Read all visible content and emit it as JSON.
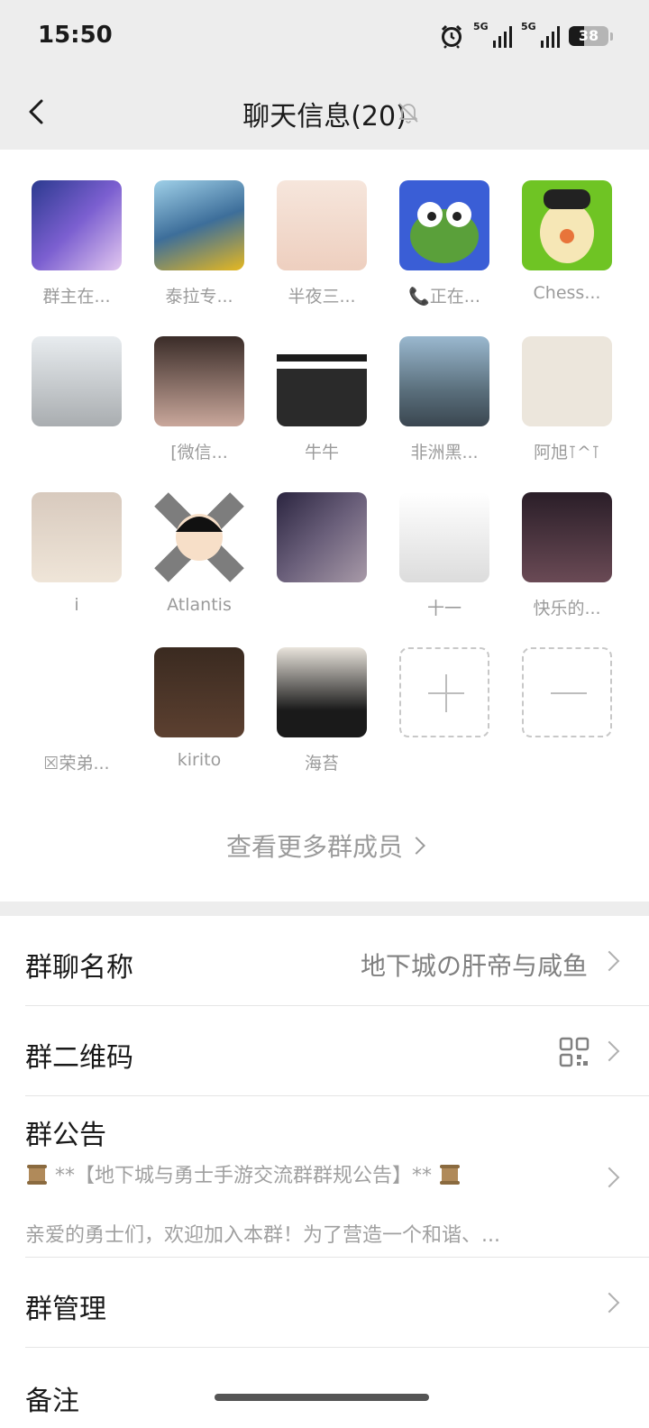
{
  "status_bar": {
    "time": "15:50",
    "network_1": "5G",
    "network_2": "5G",
    "battery_level": "38",
    "battery_fraction": 0.38,
    "icons": [
      "alarm-icon",
      "signal-icon",
      "signal-icon",
      "battery-icon"
    ]
  },
  "nav": {
    "title": "聊天信息(20)",
    "back_icon": "chevron-left-icon",
    "mute_icon": "bell-off-icon"
  },
  "members": [
    {
      "name": "群主在..."
    },
    {
      "name": "泰拉专..."
    },
    {
      "name": "半夜三..."
    },
    {
      "name": "📞正在..."
    },
    {
      "name": "Chess..."
    },
    {
      "name": ""
    },
    {
      "name": "[微信..."
    },
    {
      "name": "牛牛"
    },
    {
      "name": "非洲黑..."
    },
    {
      "name": "阿旭⊺^⊺"
    },
    {
      "name": "i"
    },
    {
      "name": "Atlantis"
    },
    {
      "name": ""
    },
    {
      "name": "十一"
    },
    {
      "name": "快乐的..."
    },
    {
      "name": "☒荣弟..."
    },
    {
      "name": "kirito"
    },
    {
      "name": "海苔"
    }
  ],
  "actions": {
    "add_icon": "plus-icon",
    "remove_icon": "minus-icon"
  },
  "view_more": "查看更多群成员",
  "settings": {
    "group_name_label": "群聊名称",
    "group_name_value": "地下城の肝帝与咸鱼",
    "qr_label": "群二维码",
    "qr_icon": "qr-code-icon",
    "announcement_label": "群公告",
    "announcement_title": "**【地下城与勇士手游交流群群规公告】**",
    "announcement_preview": "亲爱的勇士们，欢迎加入本群！为了营造一个和谐、...",
    "announcement_icon": "scroll-icon",
    "manage_label": "群管理",
    "next_label_partial": "备注"
  },
  "colors": {
    "background": "#ededed",
    "card": "#ffffff",
    "primary_text": "#1a1a1a",
    "secondary_text": "#9b9b9b"
  }
}
